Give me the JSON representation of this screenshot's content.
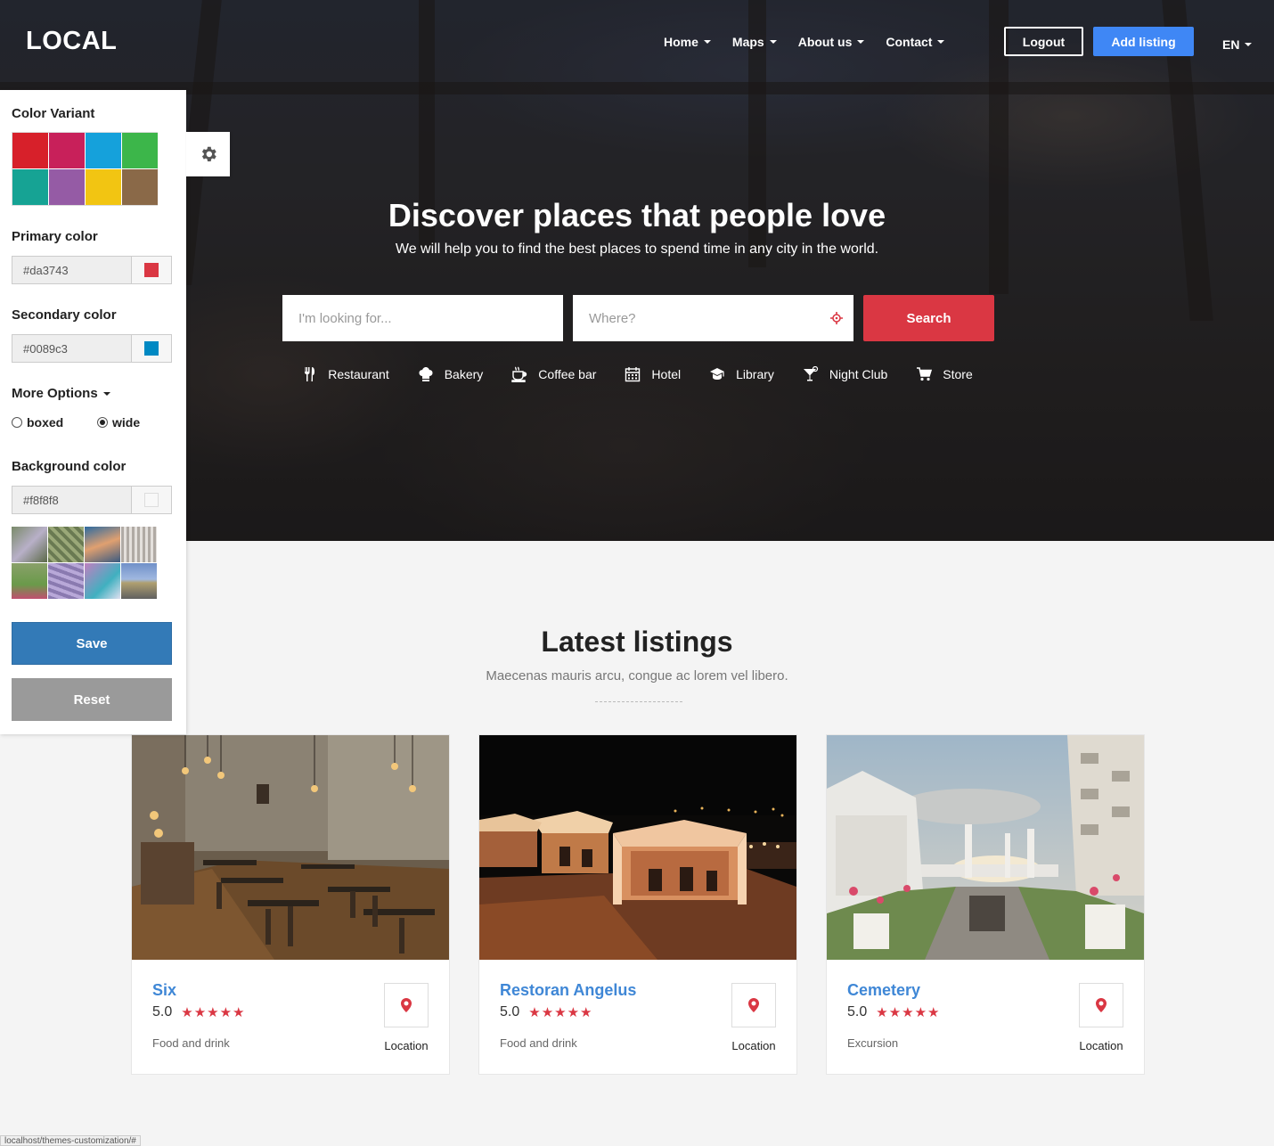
{
  "header": {
    "logo": "LOCAL",
    "nav": [
      "Home",
      "Maps",
      "About us",
      "Contact"
    ],
    "logout": "Logout",
    "add_listing": "Add listing",
    "lang": "EN"
  },
  "hero": {
    "title": "Discover places that people love",
    "subtitle": "We will help you to find the best places to spend time in any city in the world.",
    "what_placeholder": "I'm looking for...",
    "where_placeholder": "Where?",
    "search_label": "Search",
    "categories": [
      {
        "label": "Restaurant",
        "icon": "fork-knife-icon"
      },
      {
        "label": "Bakery",
        "icon": "chef-hat-icon"
      },
      {
        "label": "Coffee bar",
        "icon": "coffee-cup-icon"
      },
      {
        "label": "Hotel",
        "icon": "calendar-icon"
      },
      {
        "label": "Library",
        "icon": "graduation-cap-icon"
      },
      {
        "label": "Night Club",
        "icon": "cocktail-icon"
      },
      {
        "label": "Store",
        "icon": "cart-icon"
      }
    ]
  },
  "panel": {
    "color_variant_label": "Color Variant",
    "swatches": [
      "#d7202a",
      "#c8205a",
      "#15a1db",
      "#3cb64a",
      "#16a394",
      "#955ba5",
      "#f2c512",
      "#8a6948"
    ],
    "primary_label": "Primary color",
    "primary_value": "#da3743",
    "primary_color": "#da3743",
    "secondary_label": "Secondary color",
    "secondary_value": "#0089c3",
    "secondary_color": "#0089c3",
    "more_options_label": "More Options",
    "layout_boxed": "boxed",
    "layout_wide": "wide",
    "layout_selected": "wide",
    "background_label": "Background color",
    "background_value": "#f8f8f8",
    "background_color": "#f8f8f8",
    "save_label": "Save",
    "reset_label": "Reset"
  },
  "listings": {
    "title": "Latest listings",
    "subtitle": "Maecenas mauris arcu, congue ac lorem vel libero.",
    "items": [
      {
        "name": "Six",
        "rating": "5.0",
        "category": "Food and drink",
        "location_label": "Location"
      },
      {
        "name": "Restoran Angelus",
        "rating": "5.0",
        "category": "Food and drink",
        "location_label": "Location"
      },
      {
        "name": "Cemetery",
        "rating": "5.0",
        "category": "Excursion",
        "location_label": "Location"
      }
    ]
  },
  "statusbar": "localhost/themes-customization/#"
}
